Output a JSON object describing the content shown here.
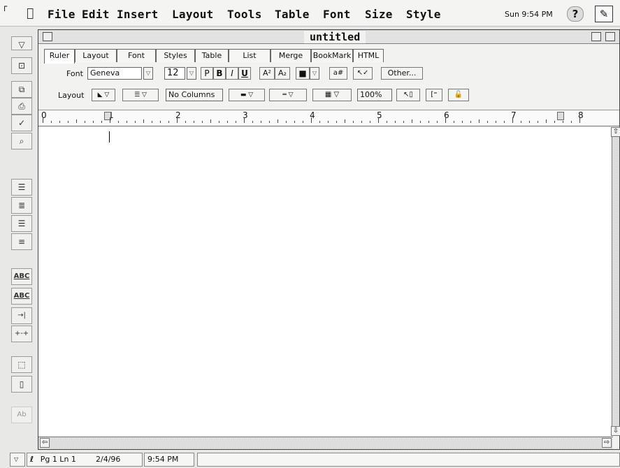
{
  "menubar": {
    "items": [
      "File",
      "Edit",
      "Insert",
      "Layout",
      "Tools",
      "Table",
      "Font",
      "Size",
      "Style"
    ],
    "clock": "Sun 9:54 PM",
    "help_glyph": "?",
    "app_glyph": "✎",
    "corner_glyph": "┌"
  },
  "palette": {
    "buttons": [
      {
        "name": "palette-dropdown-icon",
        "glyph": "▽"
      },
      {
        "name": "new-document-icon",
        "glyph": "⊡"
      },
      {
        "name": "save-icon",
        "glyph": "⧉"
      },
      {
        "name": "print-icon",
        "glyph": "⎙"
      },
      {
        "name": "spell-check-icon",
        "glyph": "✓"
      },
      {
        "name": "find-icon",
        "glyph": "⌕"
      },
      {
        "name": "bullet-list-icon",
        "glyph": "☰"
      },
      {
        "name": "numbered-list-icon",
        "glyph": "≣"
      },
      {
        "name": "indent-list-icon",
        "glyph": "☰"
      },
      {
        "name": "outline-icon",
        "glyph": "≡"
      },
      {
        "name": "abc-button-1",
        "glyph": "ABC"
      },
      {
        "name": "abc-button-2",
        "glyph": "ABC"
      },
      {
        "name": "tab-right-icon",
        "glyph": "→|"
      },
      {
        "name": "tab-dots-icon",
        "glyph": "+-+"
      },
      {
        "name": "insert-page-icon",
        "glyph": "⬚"
      },
      {
        "name": "page-icon",
        "glyph": "▯"
      },
      {
        "name": "text-style-icon",
        "glyph": "Ab"
      }
    ]
  },
  "window": {
    "title": "untitled",
    "tabs": [
      "Ruler",
      "Layout",
      "Font",
      "Styles",
      "Table",
      "List",
      "Merge",
      "BookMark",
      "HTML"
    ],
    "font_row": {
      "label": "Font",
      "font_name": "Geneva",
      "font_size": "12",
      "plain": "P",
      "bold": "B",
      "italic": "I",
      "underline": "U",
      "superscript": "A²",
      "subscript": "A₂",
      "color_swatch": "■",
      "other_button": "Other..."
    },
    "layout_row": {
      "label": "Layout",
      "columns": "No Columns",
      "zoom": "100%"
    },
    "ruler_numbers": [
      "0",
      "1",
      "2",
      "3",
      "4",
      "5",
      "6",
      "7",
      "8"
    ]
  },
  "status": {
    "page_line": "Pg 1  Ln 1",
    "date": "2/4/96",
    "time": "9:54 PM"
  }
}
